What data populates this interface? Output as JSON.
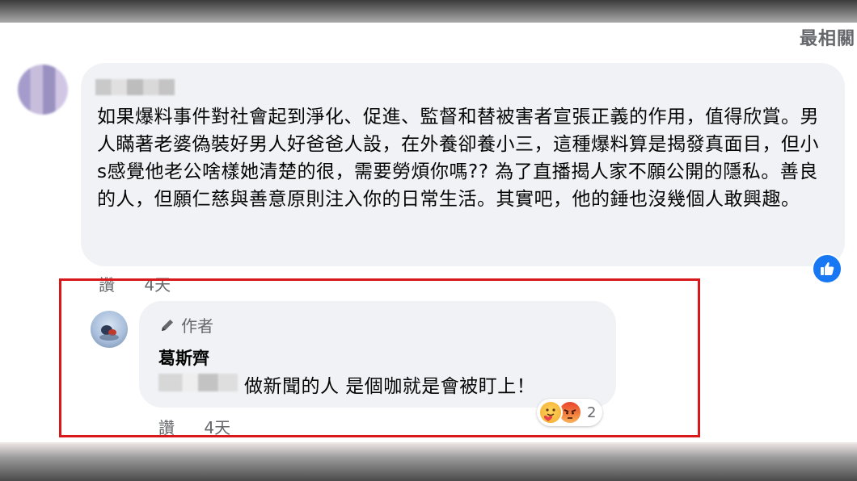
{
  "header": {
    "sort_label": "最相關"
  },
  "comment": {
    "text": "如果爆料事件對社會起到淨化、促進、監督和替被害者宣張正義的作用，值得欣賞。男人瞞著老婆偽裝好男人好爸爸人設，在外養卻養小三，這種爆料算是揭發真面目，但小s感覺他老公啥樣她清楚的很，需要勞煩你嗎?? 為了直播揭人家不願公開的隱私。善良的人，但願仁慈與善意原則注入你的日常生活。其實吧，他的錘也沒幾個人敢興趣。",
    "action_label": "讚",
    "time": "4天",
    "reaction_icon": "like-icon"
  },
  "reply": {
    "author_tag": "作者",
    "author_icon": "pencil-icon",
    "name": "葛斯齊",
    "text": "做新聞的人 是個咖就是會被盯上！",
    "action_label": "讚",
    "time": "4天",
    "reactions": [
      "care-emoji",
      "angry-emoji"
    ],
    "reaction_count": "2"
  },
  "colors": {
    "highlight_border": "#d9181c",
    "bubble_bg": "#f0f2f5",
    "like_blue": "#1877f2",
    "meta_gray": "#65676b"
  }
}
